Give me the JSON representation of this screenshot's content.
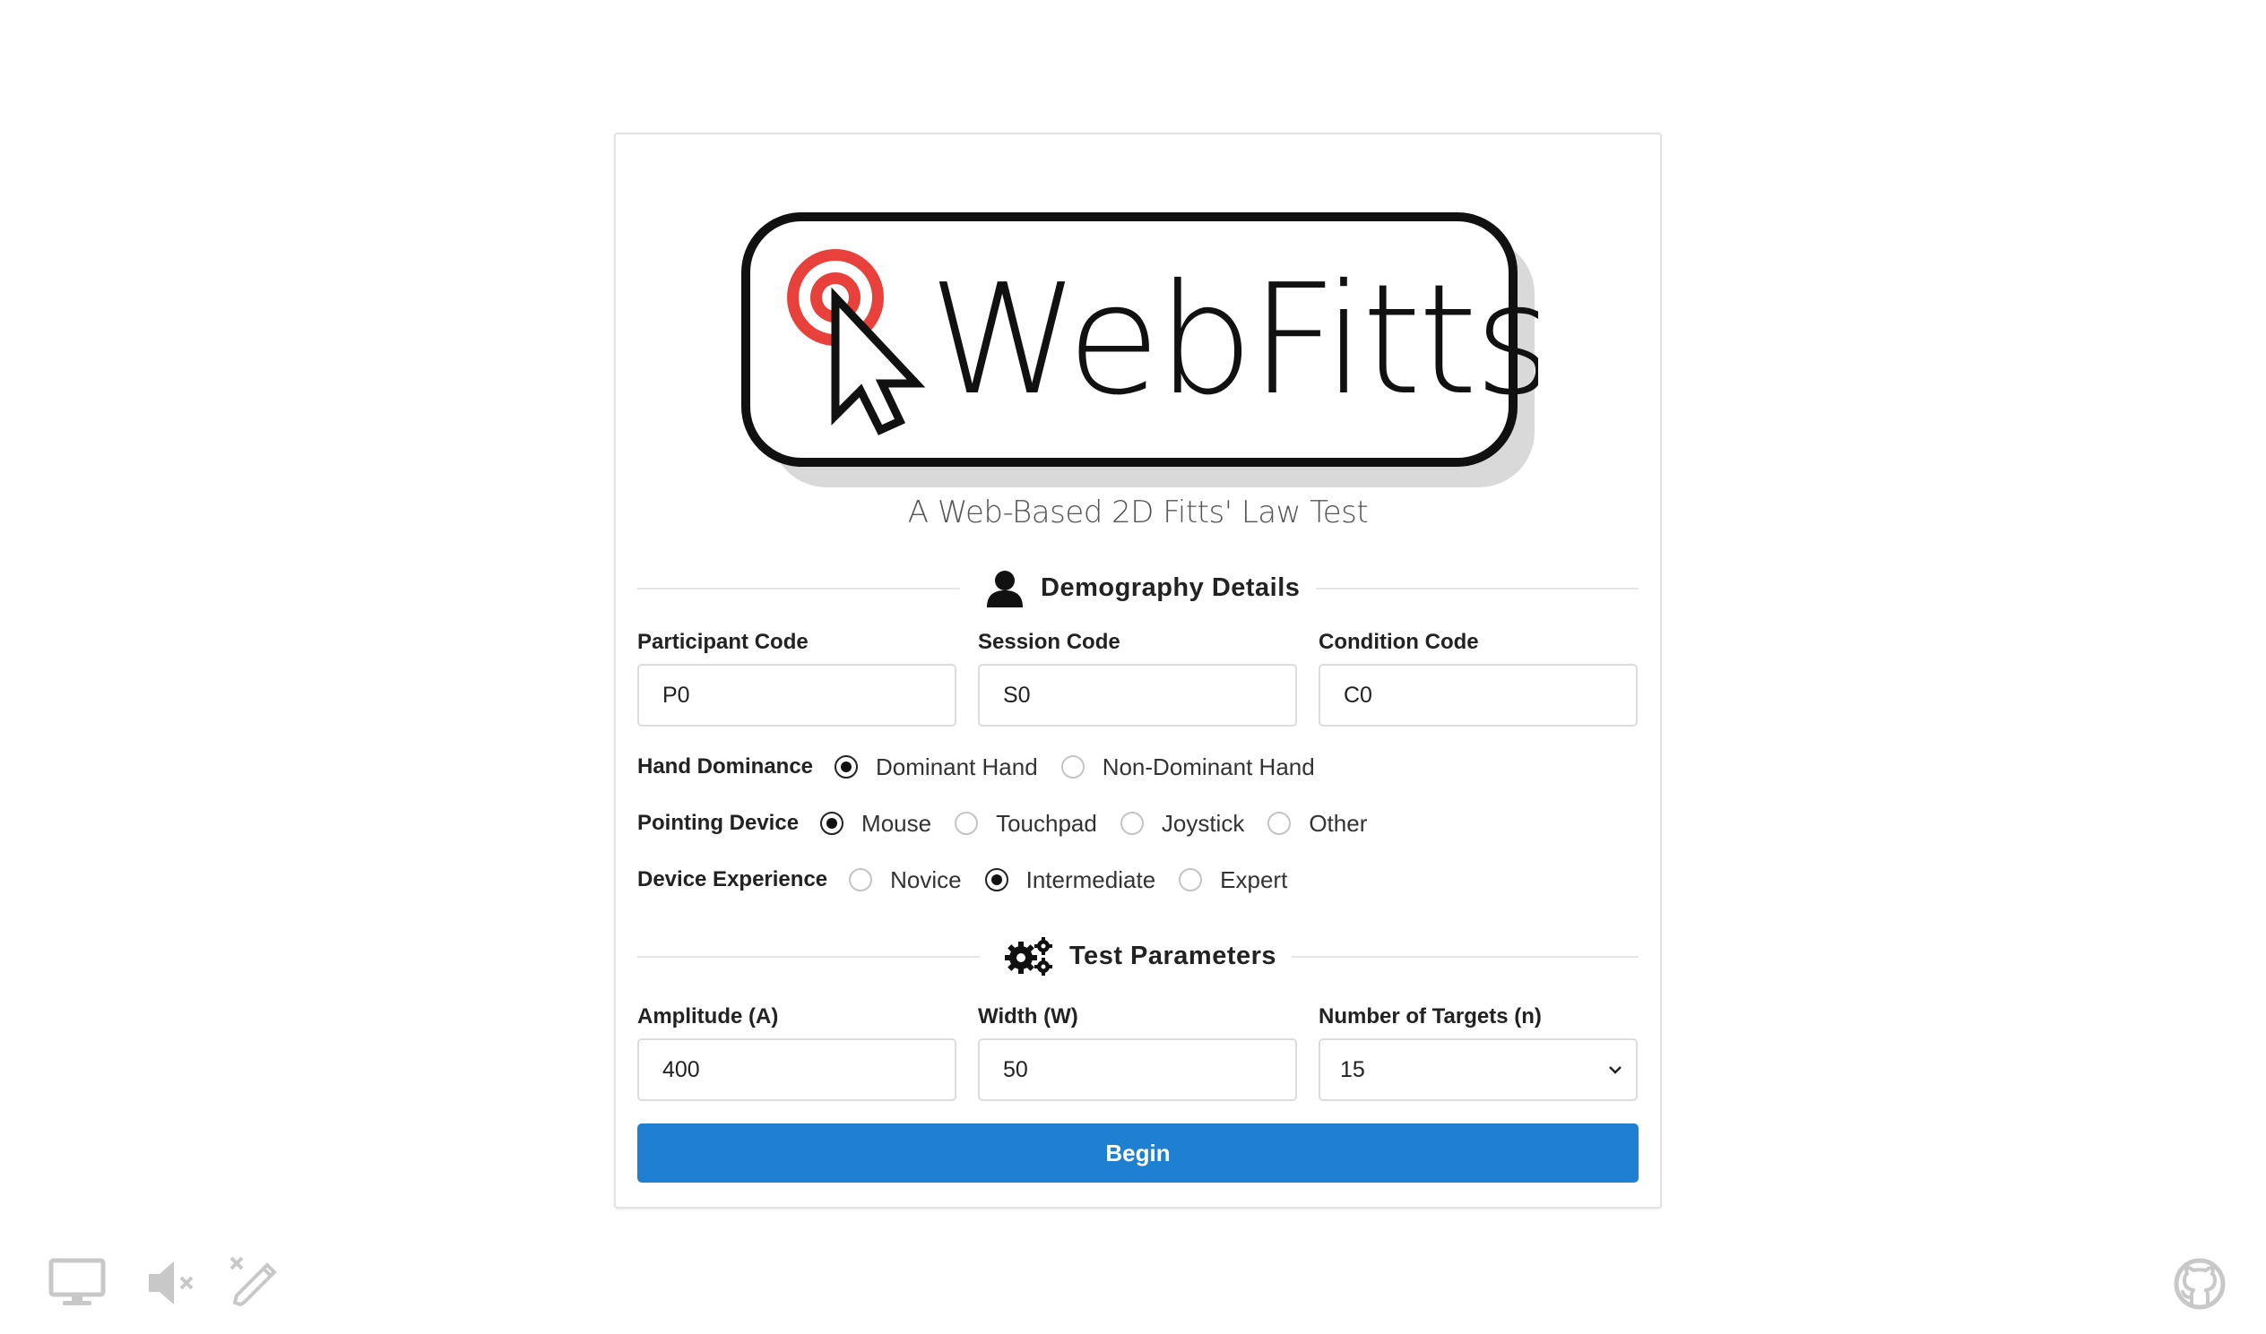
{
  "logo": {
    "text": "WebFitts"
  },
  "subtitle": "A Web-Based 2D Fitts' Law Test",
  "demography": {
    "title": "Demography Details",
    "participant": {
      "label": "Participant Code",
      "value": "P0"
    },
    "session": {
      "label": "Session Code",
      "value": "S0"
    },
    "condition": {
      "label": "Condition Code",
      "value": "C0"
    },
    "hand": {
      "label": "Hand Dominance",
      "options": [
        "Dominant Hand",
        "Non-Dominant Hand"
      ],
      "selected": "Dominant Hand"
    },
    "device": {
      "label": "Pointing Device",
      "options": [
        "Mouse",
        "Touchpad",
        "Joystick",
        "Other"
      ],
      "selected": "Mouse"
    },
    "experience": {
      "label": "Device Experience",
      "options": [
        "Novice",
        "Intermediate",
        "Expert"
      ],
      "selected": "Intermediate"
    }
  },
  "test": {
    "title": "Test Parameters",
    "amplitude": {
      "label": "Amplitude (A)",
      "value": "400"
    },
    "width": {
      "label": "Width (W)",
      "value": "50"
    },
    "targets": {
      "label": "Number of Targets (n)",
      "value": "15"
    }
  },
  "begin_label": "Begin",
  "colors": {
    "accent": "#1f7fd0",
    "target_red": "#e8403a"
  },
  "footer_icons": [
    "monitor-icon",
    "speaker-muted-icon",
    "pencil-disabled-icon",
    "github-icon"
  ]
}
